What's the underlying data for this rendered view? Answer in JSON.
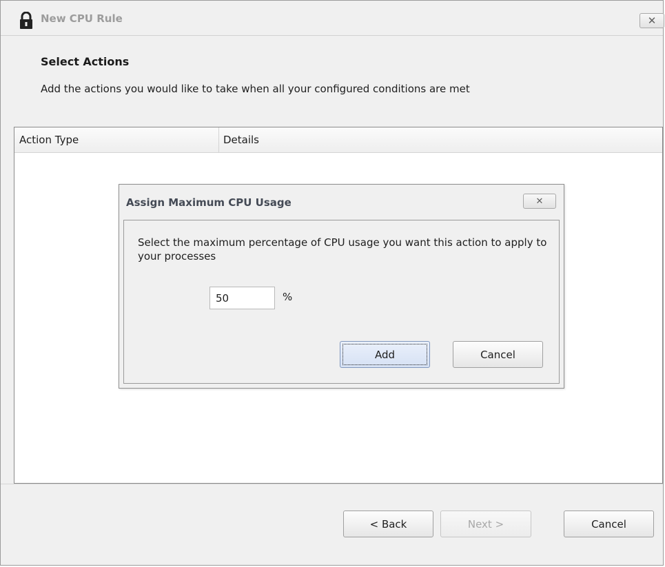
{
  "window": {
    "title": "New CPU Rule",
    "close_label": "✕"
  },
  "header": {
    "title": "Select Actions",
    "description": "Add the actions you would like to take when all your configured conditions are met"
  },
  "actions_table": {
    "columns": [
      "Action Type",
      "Details"
    ],
    "rows": []
  },
  "footer": {
    "back_label": "< Back",
    "next_label": "Next >",
    "cancel_label": "Cancel"
  },
  "dialog": {
    "title": "Assign Maximum CPU Usage",
    "close_label": "✕",
    "description": "Select the maximum percentage of CPU usage you want this action to apply to your processes",
    "cpu_value": "50",
    "unit": "%",
    "add_label": "Add",
    "cancel_label": "Cancel"
  },
  "colors": {
    "window_bg": "#f0f0f0",
    "disabled_text": "#a8a8a8",
    "default_button_bg": "#d6e1f4"
  }
}
